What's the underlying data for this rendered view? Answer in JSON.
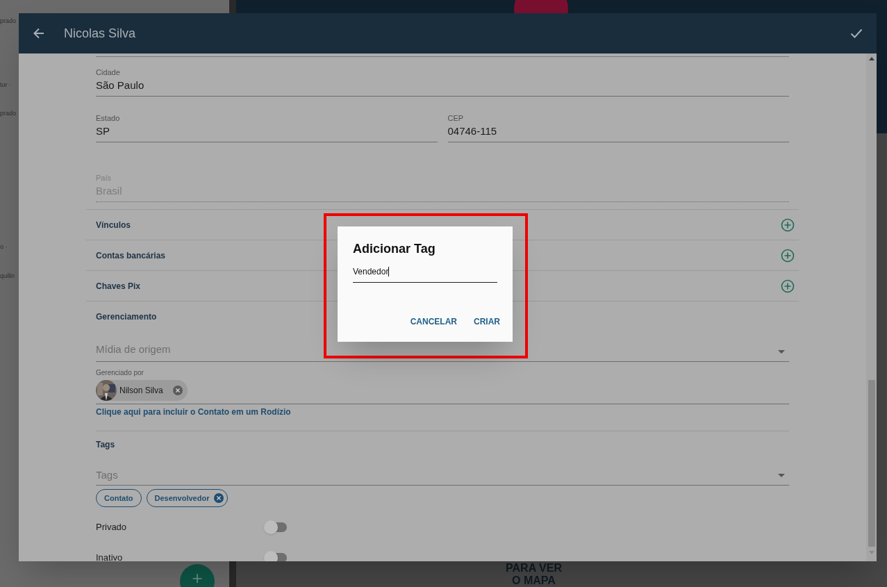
{
  "background": {
    "side_texts": [
      "prado",
      "tor ·",
      "prado",
      "o ·",
      "quilin"
    ],
    "map_texts": [
      "PARA VER",
      "O MAPA"
    ],
    "fab": "+"
  },
  "header": {
    "title": "Nicolas Silva"
  },
  "field_rows": [
    [
      {
        "label": "Cidade",
        "value": "São Paulo",
        "disabled": false
      }
    ],
    [
      {
        "label": "Estado",
        "value": "SP",
        "disabled": false
      },
      {
        "label": "CEP",
        "value": "04746-115",
        "disabled": false
      }
    ],
    [
      {
        "label": "País",
        "value": "Brasil",
        "disabled": true
      }
    ]
  ],
  "sections": [
    {
      "title": "Vínculos",
      "addable": true
    },
    {
      "title": "Contas bancárias",
      "addable": true
    },
    {
      "title": "Chaves Pix",
      "addable": true
    },
    {
      "title": "Gerenciamento",
      "addable": false
    }
  ],
  "management": {
    "source_placeholder": "Mídia de origem",
    "managed_label": "Gerenciado por",
    "manager": {
      "name": "Nilson Silva",
      "removable": true
    },
    "link": "Clique aqui para incluir o Contato em um Rodízio"
  },
  "tags": {
    "title": "Tags",
    "placeholder": "Tags",
    "chips": [
      {
        "label": "Contato",
        "removable": false
      },
      {
        "label": "Desenvolvedor",
        "removable": true
      }
    ]
  },
  "toggles": [
    {
      "label": "Privado",
      "on": false
    },
    {
      "label": "Inativo",
      "on": false
    }
  ],
  "dialog": {
    "title": "Adicionar Tag",
    "value": "Vendedor",
    "buttons": [
      "CANCELAR",
      "CRIAR"
    ],
    "highlighted": true
  }
}
